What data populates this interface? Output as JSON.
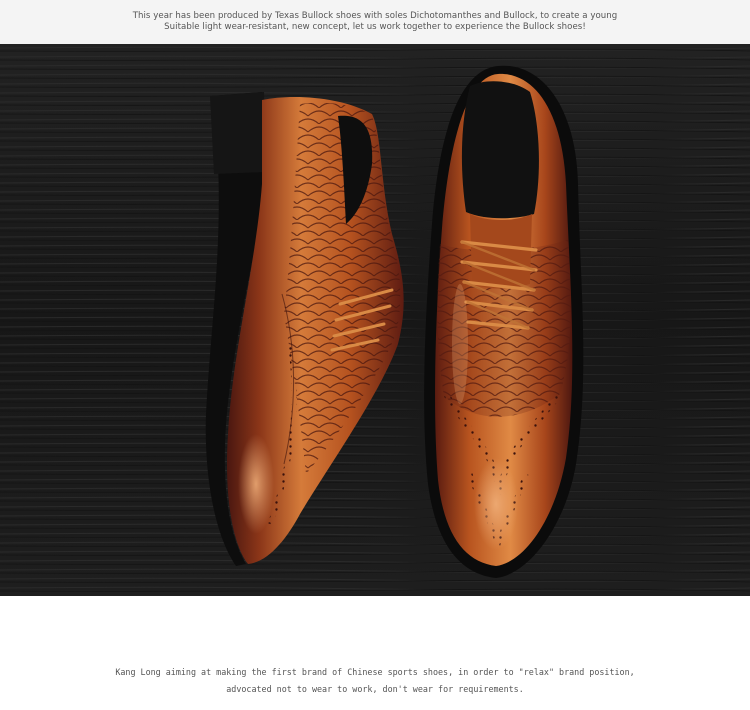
{
  "banner": {
    "line1": "This year has been produced by Texas Bullock shoes with soles Dichotomanthes and Bullock, to create a young",
    "line2": "Suitable light wear-resistant, new concept, let us work together to experience the Bullock shoes!"
  },
  "photo": {
    "subject": "pair of brown brogue oxford shoes",
    "colors": {
      "wood_background": "#1c1c1c",
      "leather_light": "#c8692a",
      "leather_dark": "#5e1c12",
      "sole": "#0d0d0d"
    }
  },
  "caption": {
    "line1": "Kang Long aiming at making the first brand of Chinese sports shoes, in order to \"relax\" brand position,",
    "line2": "advocated not to wear to work, don't wear for requirements."
  }
}
